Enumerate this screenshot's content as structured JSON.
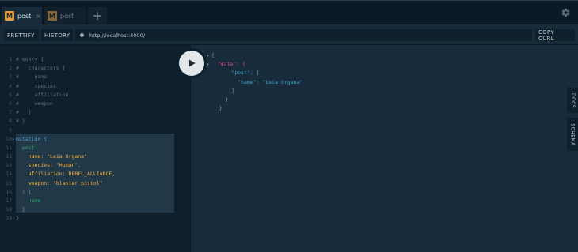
{
  "tabs": [
    {
      "badge": "M",
      "title": "post",
      "close": "×",
      "active": true
    },
    {
      "badge": "M",
      "title": "post",
      "active": false
    }
  ],
  "tabbar": {
    "add_label": "+",
    "settings_icon": "gear-icon"
  },
  "toolbar": {
    "prettify_label": "PRETTIFY",
    "history_label": "HISTORY",
    "url": "http://localhost:4000/",
    "copy_curl_label": "COPY CURL"
  },
  "editor": {
    "line_numbers": [
      "1",
      "2",
      "3",
      "4",
      "5",
      "6",
      "7",
      "8",
      "9",
      "10",
      "11",
      "12",
      "13",
      "14",
      "15",
      "16",
      "17",
      "18",
      "19"
    ],
    "lines": [
      "# query {",
      "#   characters {",
      "#     name",
      "#     species",
      "#     affiliation",
      "#     weapon",
      "#   }",
      "# }",
      "",
      "mutation {",
      "  post(",
      "    name: \"Leia Organa\"",
      "    species: \"Human\",",
      "    affiliation: REBEL_ALLIANCE,",
      "    weapon: \"blaster pistol\"",
      "  ) {",
      "    name",
      "  }",
      "}"
    ]
  },
  "result": {
    "lines": [
      "{",
      "\"data\": {",
      "\"post\": {",
      "\"name\": \"Leia Organa\"",
      "}",
      "}",
      "}"
    ]
  },
  "side_tabs": {
    "docs_label": "DOCS",
    "schema_label": "SCHEMA"
  },
  "colors": {
    "background": "#0f202d",
    "result_background": "#172b3a",
    "badge": "#e39f3b",
    "keyword": "#4a9ec9",
    "field": "#2fa36b",
    "attribute": "#f0b03f",
    "string": "#d64292"
  }
}
